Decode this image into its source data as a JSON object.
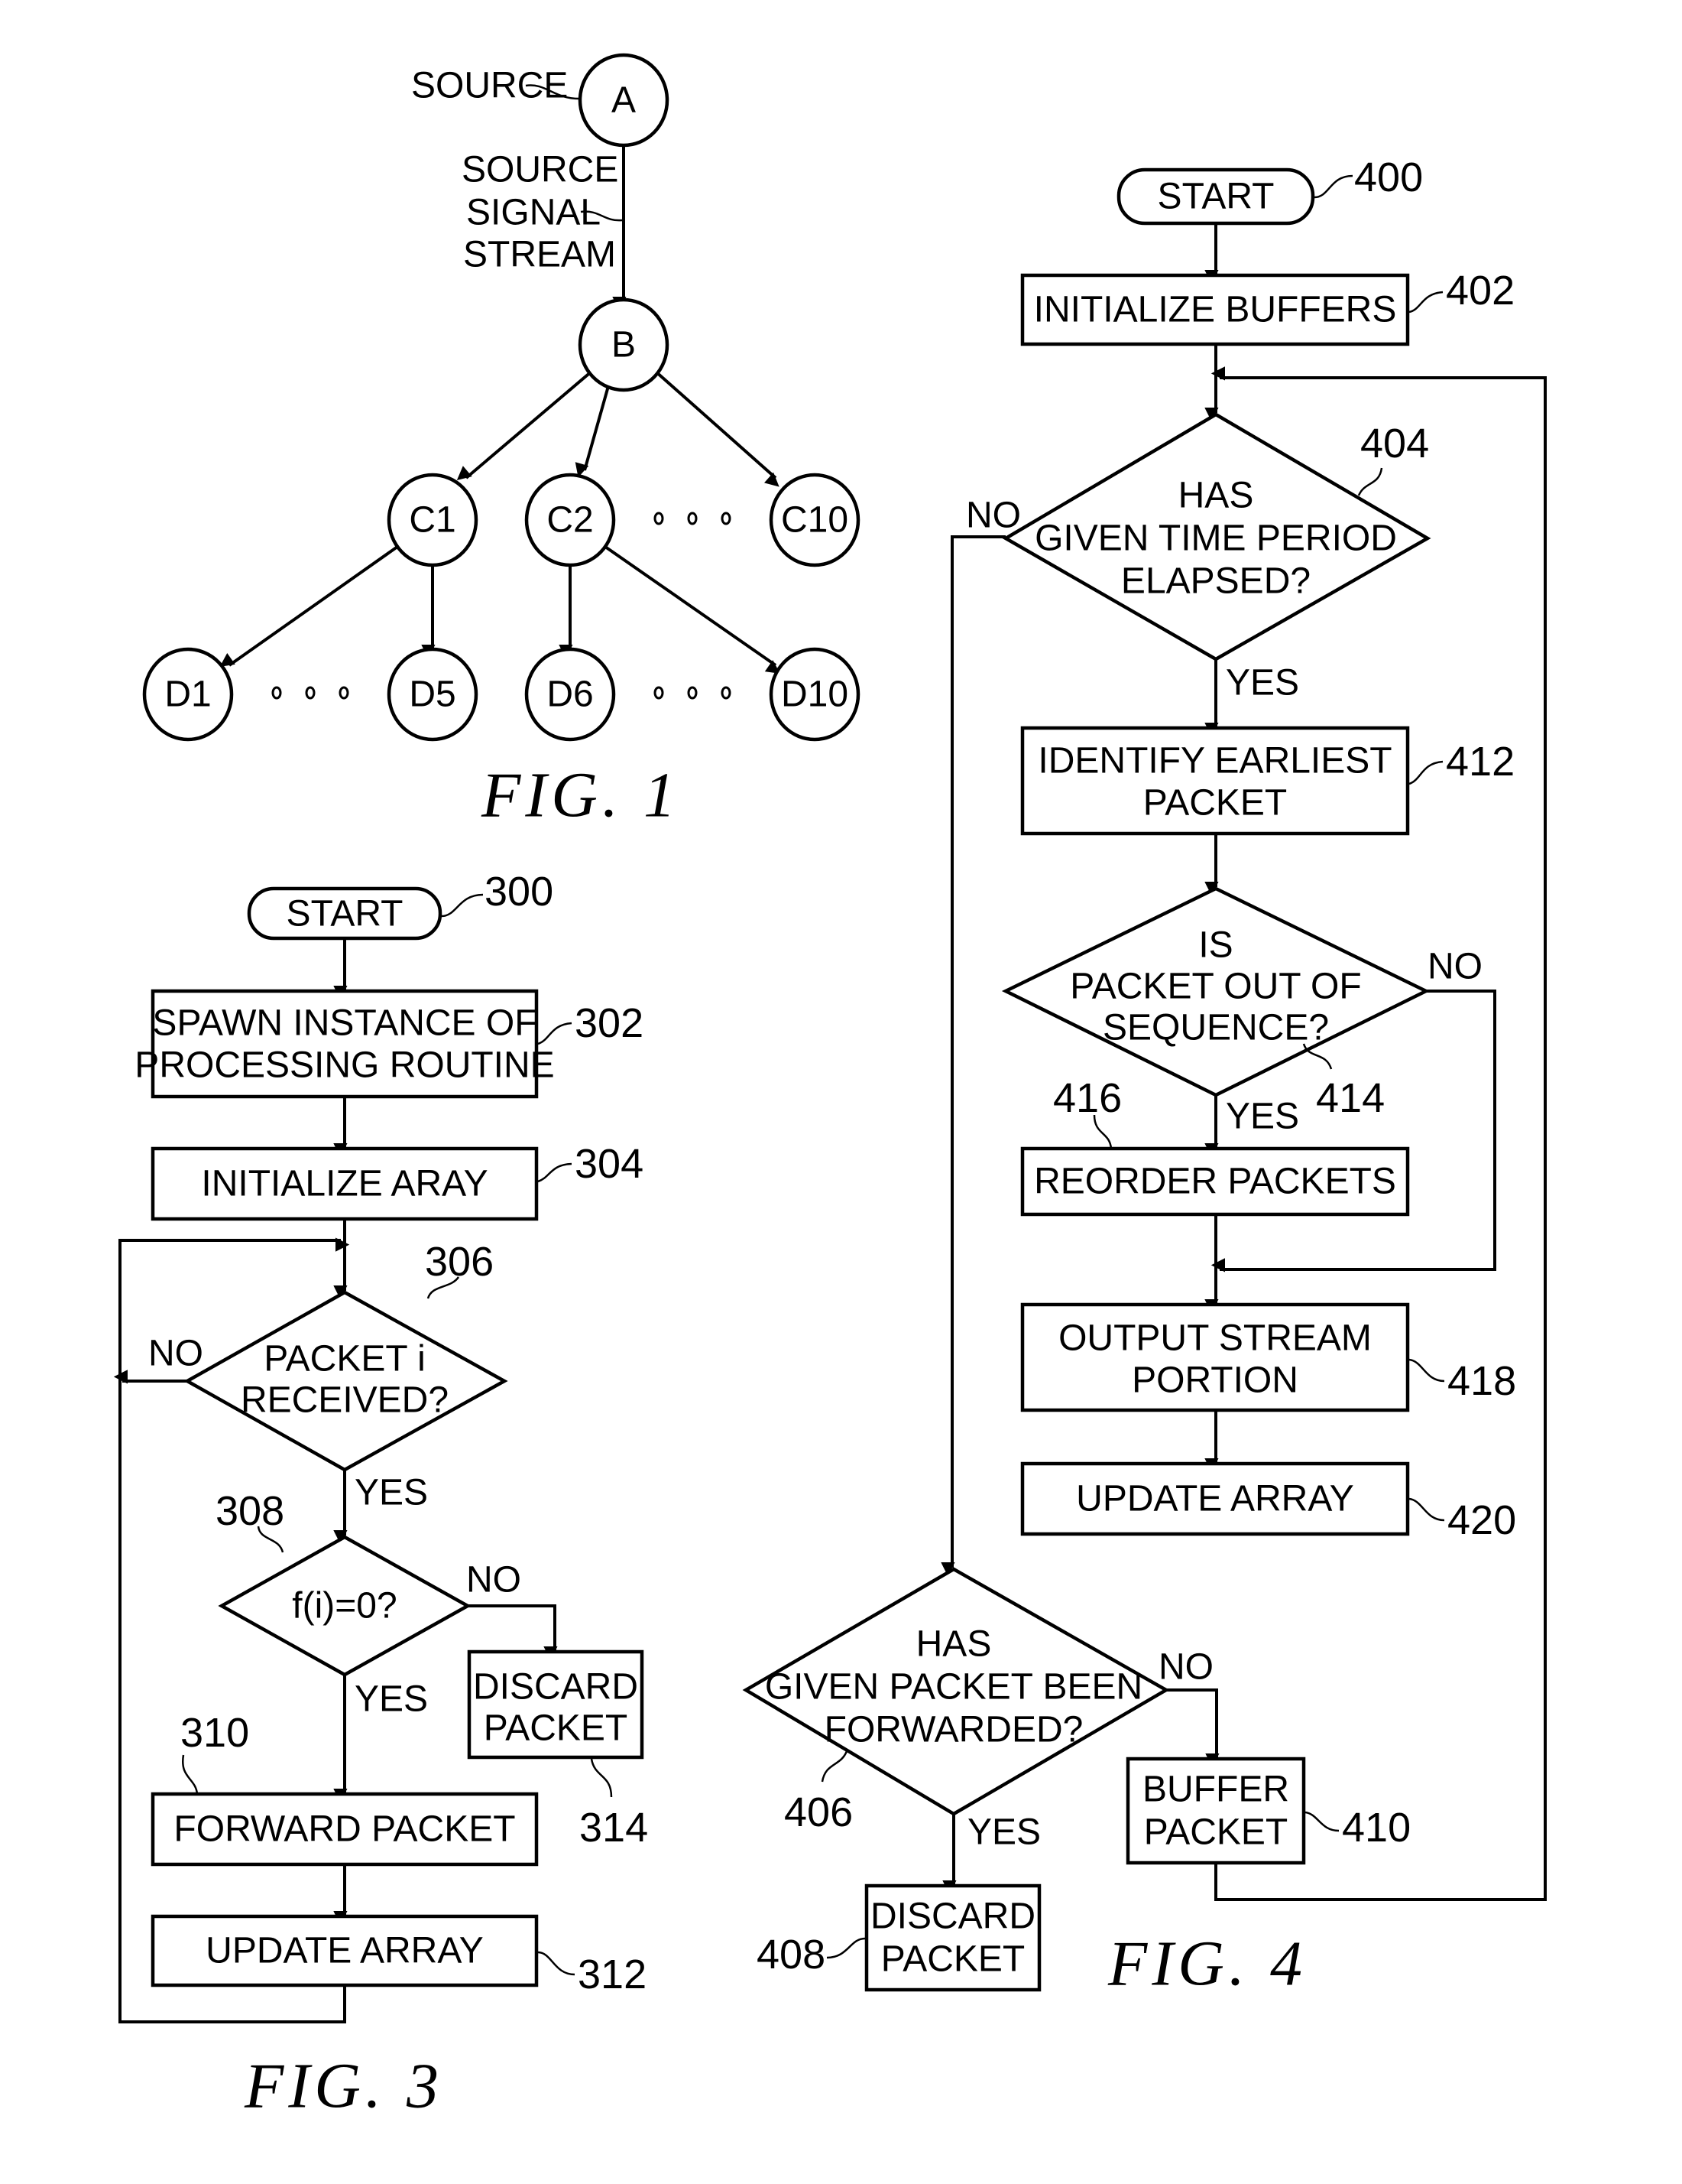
{
  "fig1": {
    "caption": "FIG. 1",
    "source_label": "SOURCE",
    "stream_label": [
      "SOURCE",
      "SIGNAL",
      "STREAM"
    ],
    "nodes": {
      "A": "A",
      "B": "B",
      "C1": "C1",
      "C2": "C2",
      "C10": "C10",
      "D1": "D1",
      "D5": "D5",
      "D6": "D6",
      "D10": "D10"
    },
    "edges": [
      [
        "A",
        "B"
      ],
      [
        "B",
        "C1"
      ],
      [
        "B",
        "C2"
      ],
      [
        "B",
        "C10"
      ],
      [
        "C1",
        "D1"
      ],
      [
        "C1",
        "D5"
      ],
      [
        "C2",
        "D6"
      ],
      [
        "C2",
        "D10"
      ]
    ]
  },
  "fig3": {
    "caption": "FIG. 3",
    "start": {
      "label": "START",
      "ref": "300"
    },
    "s302": {
      "lines": [
        "SPAWN INSTANCE OF",
        "PROCESSING ROUTINE"
      ],
      "ref": "302"
    },
    "s304": {
      "label": "INITIALIZE ARAY",
      "ref": "304"
    },
    "d306": {
      "lines": [
        "PACKET i",
        "RECEIVED?"
      ],
      "ref": "306",
      "no": "NO",
      "yes": "YES"
    },
    "d308": {
      "label": "f(i)=0?",
      "ref": "308",
      "no": "NO",
      "yes": "YES"
    },
    "s310": {
      "label": "FORWARD PACKET",
      "ref": "310"
    },
    "s312": {
      "label": "UPDATE ARRAY",
      "ref": "312"
    },
    "s314": {
      "lines": [
        "DISCARD",
        "PACKET"
      ],
      "ref": "314"
    }
  },
  "fig4": {
    "caption": "FIG. 4",
    "start": {
      "label": "START",
      "ref": "400"
    },
    "s402": {
      "label": "INITIALIZE BUFFERS",
      "ref": "402"
    },
    "d404": {
      "lines": [
        "HAS",
        "GIVEN TIME PERIOD",
        "ELAPSED?"
      ],
      "ref": "404",
      "no": "NO",
      "yes": "YES"
    },
    "s412": {
      "lines": [
        "IDENTIFY EARLIEST",
        "PACKET"
      ],
      "ref": "412"
    },
    "d414": {
      "lines": [
        "IS",
        "PACKET OUT OF",
        "SEQUENCE?"
      ],
      "ref": "414",
      "no": "NO",
      "yes": "YES"
    },
    "s416": {
      "label": "REORDER PACKETS",
      "ref": "416"
    },
    "s418": {
      "lines": [
        "OUTPUT STREAM",
        "PORTION"
      ],
      "ref": "418"
    },
    "s420": {
      "label": "UPDATE ARRAY",
      "ref": "420"
    },
    "d406": {
      "lines": [
        "HAS",
        "GIVEN PACKET BEEN",
        "FORWARDED?"
      ],
      "ref": "406",
      "no": "NO",
      "yes": "YES"
    },
    "s408": {
      "lines": [
        "DISCARD",
        "PACKET"
      ],
      "ref": "408"
    },
    "s410": {
      "lines": [
        "BUFFER",
        "PACKET"
      ],
      "ref": "410"
    }
  }
}
